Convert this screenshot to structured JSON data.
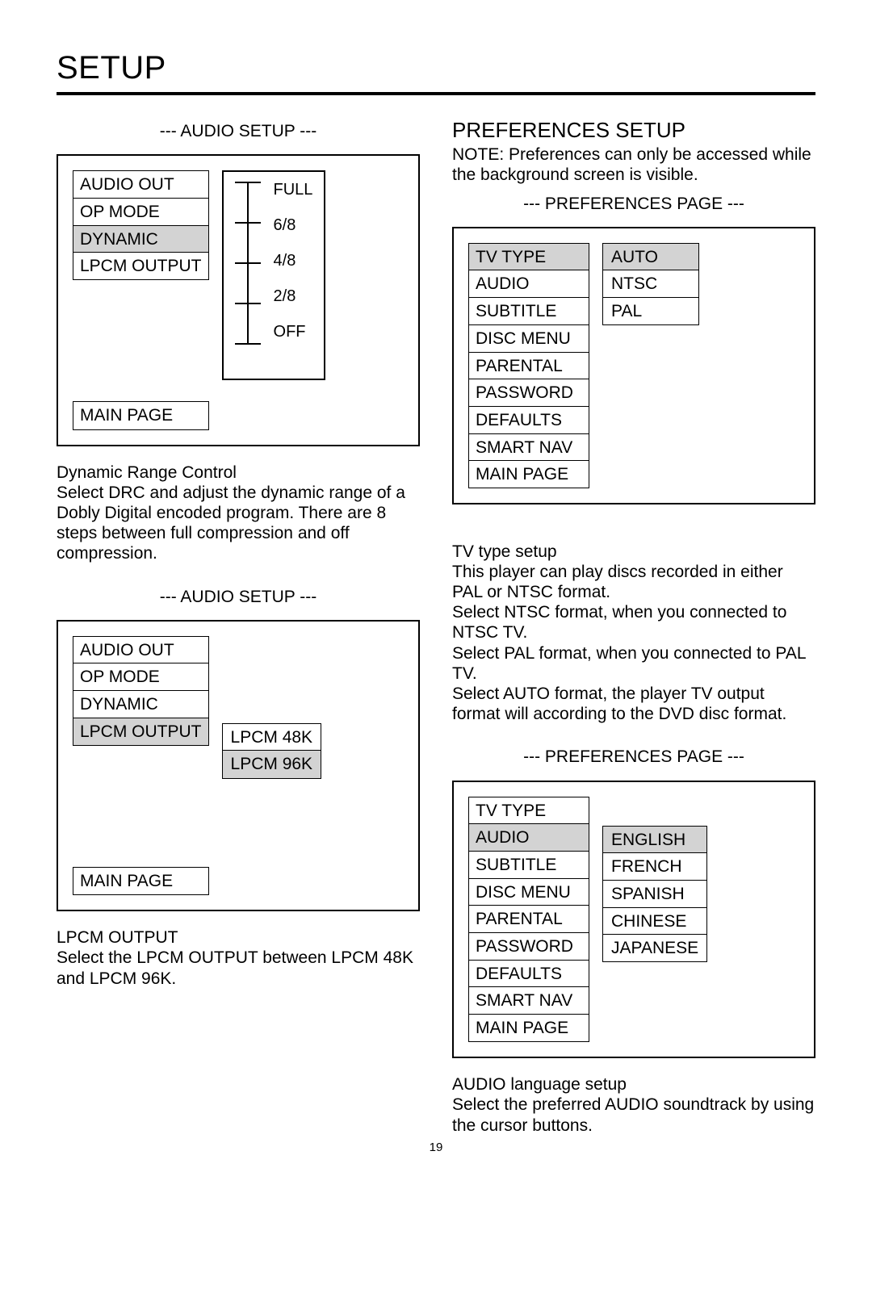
{
  "page": {
    "title": "SETUP",
    "number": "19"
  },
  "left": {
    "audio1": {
      "header": "--- AUDIO SETUP ---",
      "menu": [
        "AUDIO OUT",
        "OP MODE",
        "DYNAMIC",
        "LPCM OUTPUT"
      ],
      "selected": "DYNAMIC",
      "bottom": "MAIN PAGE",
      "slider": [
        "FULL",
        "6/8",
        "4/8",
        "2/8",
        "OFF"
      ]
    },
    "desc1_title": "Dynamic Range Control",
    "desc1_body": "Select DRC and adjust the dynamic range of a Dobly Digital encoded program.  There are 8 steps between full compression and off compression.",
    "audio2": {
      "header": "--- AUDIO SETUP ---",
      "menu": [
        "AUDIO OUT",
        "OP MODE",
        "DYNAMIC",
        "LPCM OUTPUT"
      ],
      "selected": "LPCM OUTPUT",
      "bottom": "MAIN PAGE",
      "options": [
        "LPCM 48K",
        "LPCM 96K"
      ],
      "options_selected": "LPCM 96K"
    },
    "desc2_title": "LPCM OUTPUT",
    "desc2_body": "Select the LPCM OUTPUT between LPCM 48K and LPCM 96K."
  },
  "right": {
    "heading": "PREFERENCES SETUP",
    "note": "NOTE: Preferences can only be accessed while the background screen is visible.",
    "pref1": {
      "header": "--- PREFERENCES PAGE ---",
      "menu": [
        "TV TYPE",
        "AUDIO",
        "SUBTITLE",
        "DISC MENU",
        "PARENTAL",
        "PASSWORD",
        "DEFAULTS",
        "SMART NAV",
        "MAIN PAGE"
      ],
      "selected": "TV TYPE",
      "options": [
        "AUTO",
        "NTSC",
        "PAL"
      ],
      "options_selected": "AUTO"
    },
    "desc1_title": "TV type setup",
    "desc1_body": "This player can play discs recorded in either PAL or NTSC format.\nSelect NTSC format, when you connected to NTSC TV.\nSelect PAL format, when you connected to PAL TV.\nSelect AUTO format, the player TV output format will according to the DVD disc format.",
    "pref2": {
      "header": "--- PREFERENCES PAGE ---",
      "menu": [
        "TV TYPE",
        "AUDIO",
        "SUBTITLE",
        "DISC MENU",
        "PARENTAL",
        "PASSWORD",
        "DEFAULTS",
        "SMART NAV",
        "MAIN PAGE"
      ],
      "selected": "AUDIO",
      "options": [
        "ENGLISH",
        "FRENCH",
        "SPANISH",
        "CHINESE",
        "JAPANESE"
      ],
      "options_selected": "ENGLISH"
    },
    "desc2_title": "AUDIO language setup",
    "desc2_body": "Select the preferred AUDIO soundtrack by using the cursor buttons."
  }
}
